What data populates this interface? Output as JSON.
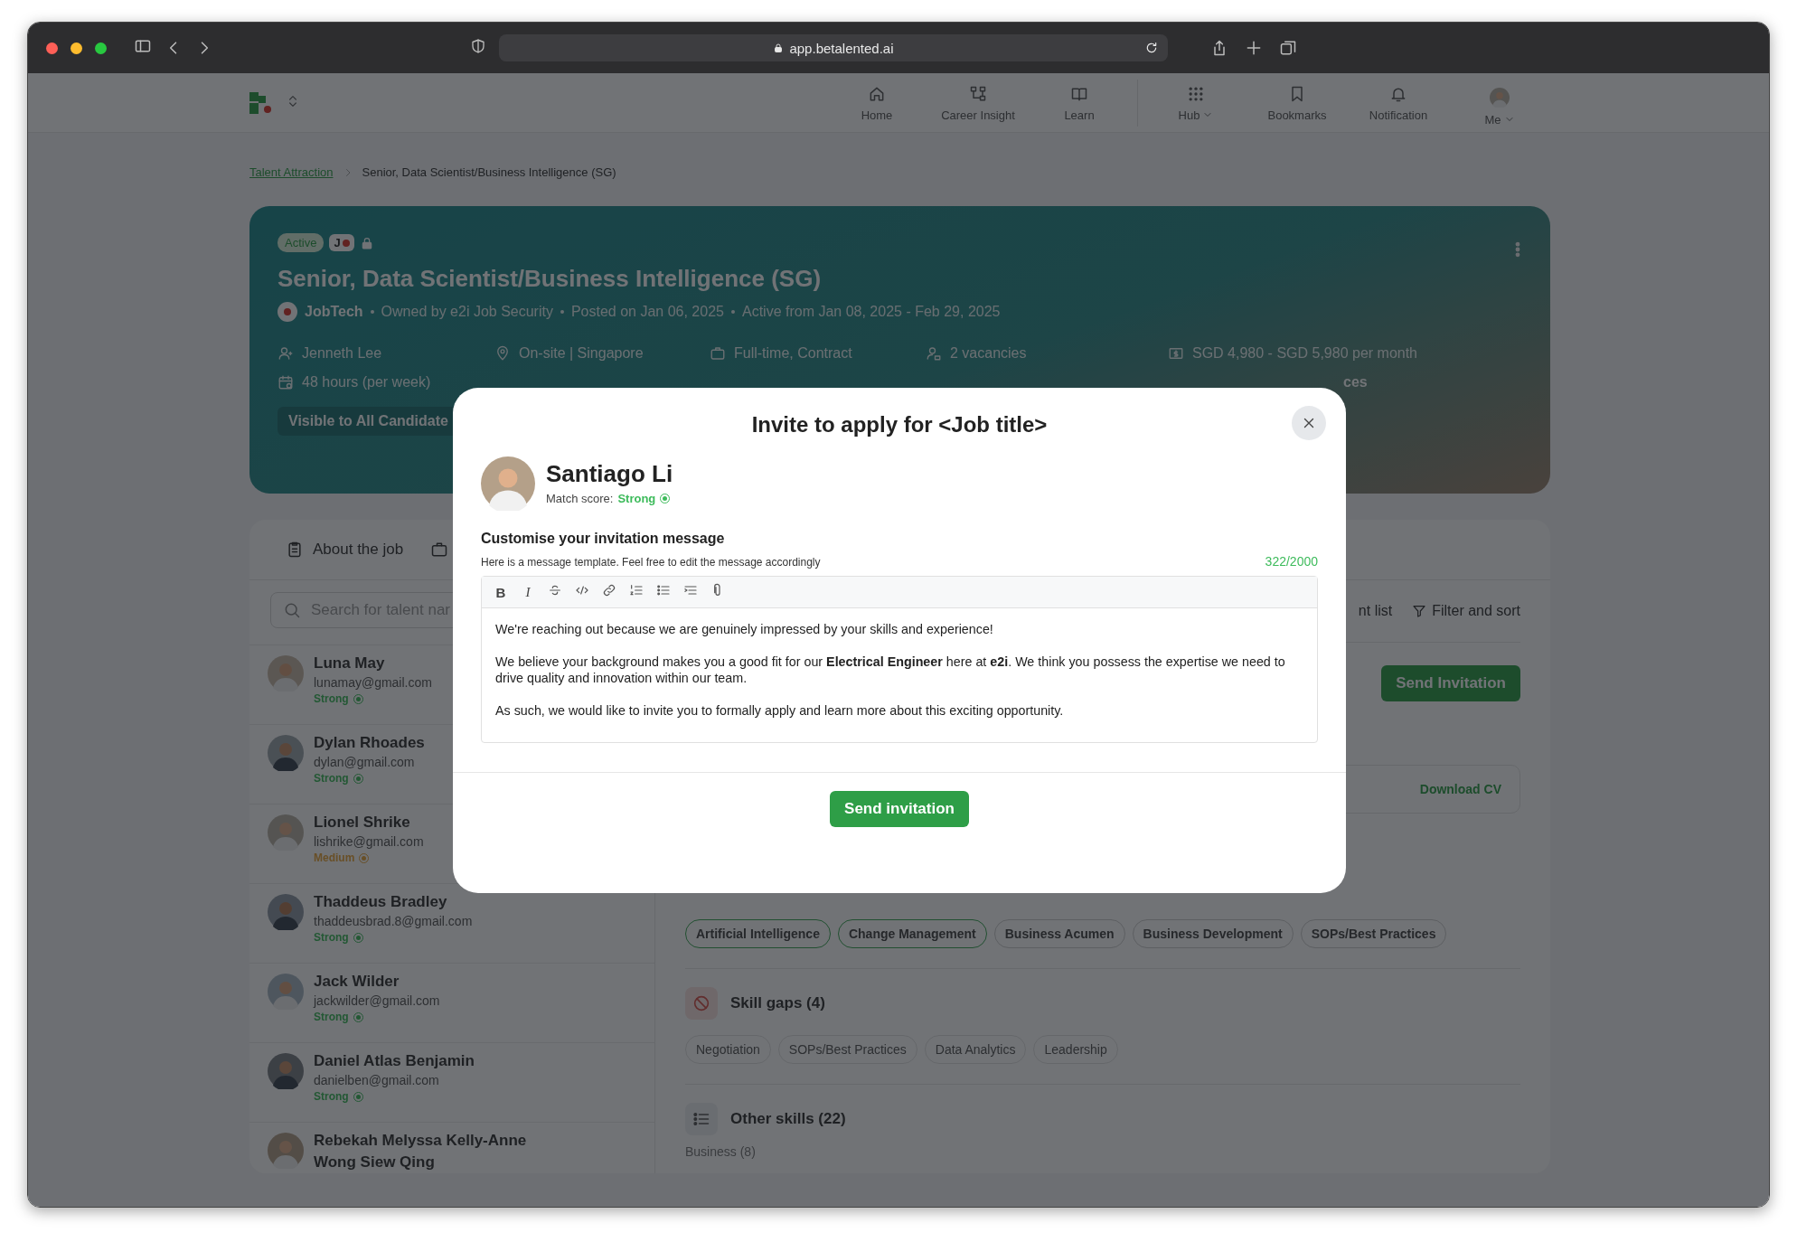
{
  "browser": {
    "url": "app.betalented.ai"
  },
  "nav": {
    "items": [
      {
        "label": "Home",
        "kind": "home",
        "dropdown": false
      },
      {
        "label": "Career Insight",
        "kind": "insight",
        "dropdown": false
      },
      {
        "label": "Learn",
        "kind": "learn",
        "dropdown": false
      },
      {
        "label": "Hub",
        "kind": "hub",
        "dropdown": true
      },
      {
        "label": "Bookmarks",
        "kind": "bookmark",
        "dropdown": false
      },
      {
        "label": "Notification",
        "kind": "bell",
        "dropdown": false
      },
      {
        "label": "Me",
        "kind": "me",
        "dropdown": true
      }
    ]
  },
  "breadcrumb": [
    {
      "label": "Talent Attraction",
      "kind": "link"
    },
    {
      "label": "Senior, Data Scientist/Business Intelligence (SG)",
      "kind": "current"
    }
  ],
  "job": {
    "status": "Active",
    "org_badge": "J",
    "title": "Senior, Data Scientist/Business Intelligence (SG)",
    "company": "JobTech",
    "meta": [
      "Owned by e2i Job Security",
      "Posted on Jan 06, 2025",
      "Active from Jan 08, 2025 - Feb 29, 2025"
    ],
    "details": [
      {
        "kind": "person",
        "text": "Jenneth Lee"
      },
      {
        "kind": "pin",
        "text": "On-site | Singapore"
      },
      {
        "kind": "briefcase",
        "text": "Full-time, Contract"
      },
      {
        "kind": "people",
        "text": "2 vacancies"
      },
      {
        "kind": "money",
        "text": "SGD 4,980 - SGD 5,980 per month"
      },
      {
        "kind": "calendar",
        "text": "48 hours (per week)"
      },
      {
        "kind": "cut",
        "text": "ces"
      }
    ],
    "visibility": "Visible to All Candidate"
  },
  "tabs": [
    {
      "label": "About the job",
      "kind": "clipboard"
    },
    {
      "kind": "briefcase"
    }
  ],
  "search": {
    "placeholder": "Search for talent nar"
  },
  "candidates": [
    {
      "name": "Luna May",
      "email": "lunamay@gmail.com",
      "match": "Strong",
      "kind": "strong"
    },
    {
      "name": "Dylan Rhoades",
      "email": "dylan@gmail.com",
      "match": "Strong",
      "kind": "strong"
    },
    {
      "name": "Lionel Shrike",
      "email": "lishrike@gmail.com",
      "match": "Medium",
      "kind": "medium"
    },
    {
      "name": "Thaddeus Bradley",
      "email": "thaddeusbrad.8@gmail.com",
      "match": "Strong",
      "kind": "strong"
    },
    {
      "name": "Jack Wilder",
      "email": "jackwilder@gmail.com",
      "match": "Strong",
      "kind": "strong"
    },
    {
      "name": "Daniel Atlas Benjamin",
      "email": "danielben@gmail.com",
      "match": "Strong",
      "kind": "strong"
    },
    {
      "name": "Rebekah Melyssa Kelly-Anne Wong Siew Qing"
    }
  ],
  "list_tools": {
    "list_action": "nt list",
    "filter": "Filter and sort"
  },
  "candidate_actions": {
    "send": "Send Invitation",
    "download": "Download CV"
  },
  "skills_matched": {
    "chips": [
      {
        "label": "Artificial Intelligence",
        "highlighted": true
      },
      {
        "label": "Change Management",
        "highlighted": true
      },
      {
        "label": "Business Acumen",
        "highlighted": false
      },
      {
        "label": "Business Development",
        "highlighted": false
      },
      {
        "label": "SOPs/Best Practices",
        "highlighted": false
      }
    ]
  },
  "skill_gaps": {
    "title": "Skill gaps (4)",
    "chips": [
      "Negotiation",
      "SOPs/Best Practices",
      "Data Analytics",
      "Leadership"
    ]
  },
  "other_skills": {
    "title": "Other skills (22)",
    "groups": [
      "Business (8)"
    ]
  },
  "modal": {
    "title": "Invite to apply for <Job title>",
    "candidate": {
      "name": "Santiago Li",
      "match_label": "Match score:",
      "match": "Strong",
      "kind": "strong"
    },
    "section_title": "Customise your invitation message",
    "hint": "Here is a message template. Feel free to edit the message accordingly",
    "count": "322/2000",
    "toolbar": [
      {
        "kind": "bold",
        "glyph": "B"
      },
      {
        "kind": "italic",
        "glyph": "I"
      },
      {
        "kind": "strike"
      },
      {
        "kind": "code"
      },
      {
        "kind": "link"
      },
      {
        "kind": "ol"
      },
      {
        "kind": "ul"
      },
      {
        "kind": "indent"
      },
      {
        "kind": "attach"
      }
    ],
    "paragraphs": [
      "We're reaching out because we are genuinely impressed by your skills and experience!",
      "We believe your background makes you a good fit for our **Electrical Engineer** here at **e2i**. We think you possess the expertise we need to drive quality and innovation within our team.",
      "As such, we would like to invite you to formally apply and learn more about this exciting opportunity."
    ],
    "submit": "Send invitation"
  }
}
